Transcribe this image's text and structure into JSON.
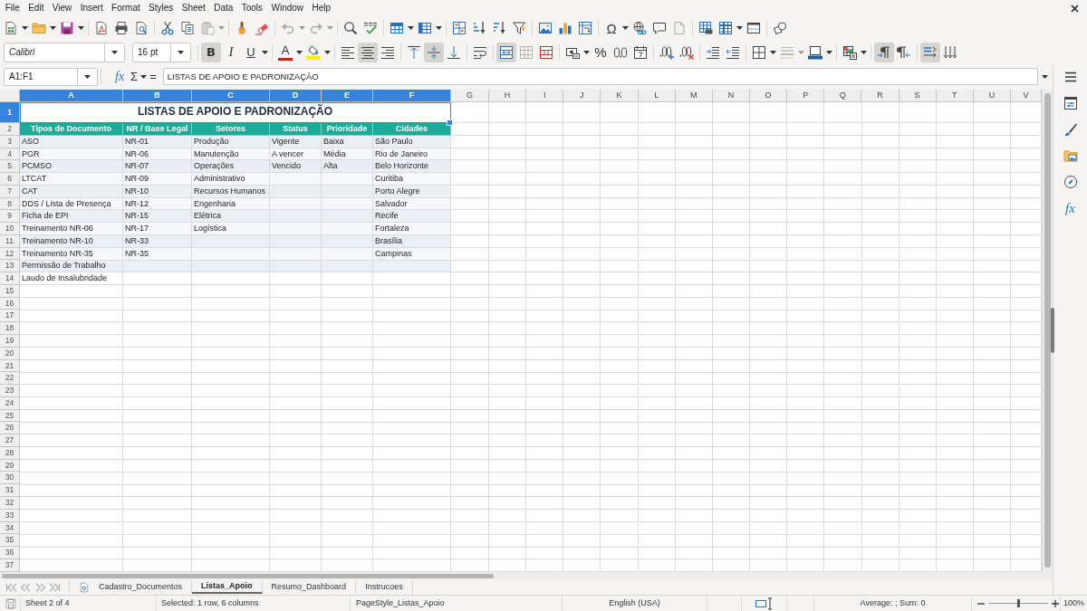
{
  "menu": [
    "File",
    "Edit",
    "View",
    "Insert",
    "Format",
    "Styles",
    "Sheet",
    "Data",
    "Tools",
    "Window",
    "Help"
  ],
  "standard_toolbar": {
    "paste_enabled": false,
    "undo_enabled": false,
    "redo_enabled": false,
    "special_character_glyph": "Ω",
    "header_footer_enabled": false
  },
  "formatting_toolbar": {
    "font_name": "Calibri",
    "font_size": "16 pt",
    "bold_glyph": "B",
    "bold": true,
    "italic_glyph": "I",
    "italic": false,
    "underline_glyph": "U",
    "underline": false,
    "font_color_glyph": "A",
    "align_left": false,
    "align_center": true,
    "align_right": false,
    "align_top": false,
    "align_middle": true,
    "align_bottom": false,
    "merge_and_center": true,
    "merge_enabled": false,
    "percent_glyph": "%",
    "border_style_enabled": false,
    "left_to_right": true,
    "right_to_left": false,
    "horizontal_text": true,
    "vertical_text": false
  },
  "formula_bar": {
    "name_box": "A1:F1",
    "function_glyph": "fx",
    "sum_glyph": "Σ",
    "equals_glyph": "=",
    "formula": "LISTAS DE APOIO E PADRONIZAÇÃO"
  },
  "sheet": {
    "column_headers": [
      {
        "label": "A",
        "selected": true
      },
      {
        "label": "B",
        "selected": true
      },
      {
        "label": "C",
        "selected": true
      },
      {
        "label": "D",
        "selected": true
      },
      {
        "label": "E",
        "selected": true
      },
      {
        "label": "F",
        "selected": true
      },
      {
        "label": "G",
        "selected": false
      },
      {
        "label": "H",
        "selected": false
      },
      {
        "label": "I",
        "selected": false
      },
      {
        "label": "J",
        "selected": false
      },
      {
        "label": "K",
        "selected": false
      },
      {
        "label": "L",
        "selected": false
      },
      {
        "label": "M",
        "selected": false
      },
      {
        "label": "N",
        "selected": false
      },
      {
        "label": "O",
        "selected": false
      },
      {
        "label": "P",
        "selected": false
      },
      {
        "label": "Q",
        "selected": false
      },
      {
        "label": "R",
        "selected": false
      },
      {
        "label": "S",
        "selected": false
      },
      {
        "label": "T",
        "selected": false
      },
      {
        "label": "U",
        "selected": false
      },
      {
        "label": "V",
        "selected": false
      }
    ],
    "row_headers": [
      {
        "label": "1",
        "selected": true
      },
      {
        "label": "2",
        "selected": false
      },
      {
        "label": "3",
        "selected": false
      },
      {
        "label": "4",
        "selected": false
      },
      {
        "label": "5",
        "selected": false
      },
      {
        "label": "6",
        "selected": false
      },
      {
        "label": "7",
        "selected": false
      },
      {
        "label": "8",
        "selected": false
      },
      {
        "label": "9",
        "selected": false
      },
      {
        "label": "10",
        "selected": false
      },
      {
        "label": "11",
        "selected": false
      },
      {
        "label": "12",
        "selected": false
      },
      {
        "label": "13",
        "selected": false
      },
      {
        "label": "14",
        "selected": false
      },
      {
        "label": "15",
        "selected": false
      },
      {
        "label": "16",
        "selected": false
      },
      {
        "label": "17",
        "selected": false
      },
      {
        "label": "18",
        "selected": false
      },
      {
        "label": "19",
        "selected": false
      },
      {
        "label": "20",
        "selected": false
      },
      {
        "label": "21",
        "selected": false
      },
      {
        "label": "22",
        "selected": false
      },
      {
        "label": "23",
        "selected": false
      },
      {
        "label": "24",
        "selected": false
      },
      {
        "label": "25",
        "selected": false
      },
      {
        "label": "26",
        "selected": false
      },
      {
        "label": "27",
        "selected": false
      },
      {
        "label": "28",
        "selected": false
      },
      {
        "label": "29",
        "selected": false
      },
      {
        "label": "30",
        "selected": false
      },
      {
        "label": "31",
        "selected": false
      },
      {
        "label": "32",
        "selected": false
      },
      {
        "label": "33",
        "selected": false
      },
      {
        "label": "34",
        "selected": false
      },
      {
        "label": "35",
        "selected": false
      },
      {
        "label": "36",
        "selected": false
      },
      {
        "label": "37",
        "selected": false
      }
    ],
    "title": "LISTAS DE APOIO E PADRONIZAÇÃO",
    "headers": [
      "Tipos de Documento",
      "NR / Base Legal",
      "Setores",
      "Status",
      "Prioridade",
      "Cidades"
    ],
    "lists": [
      [
        "ASO",
        "PGR",
        "PCMSO",
        "LTCAT",
        "CAT",
        "DDS / Lista de Presença",
        "Ficha de EPI",
        "Treinamento NR-06",
        "Treinamento NR-10",
        "Treinamento NR-35",
        "Permissão de Trabalho",
        "Laudo de Insalubridade"
      ],
      [
        "NR-01",
        "NR-06",
        "NR-07",
        "NR-09",
        "NR-10",
        "NR-12",
        "NR-15",
        "NR-17",
        "NR-33",
        "NR-35"
      ],
      [
        "Produção",
        "Manutenção",
        "Operações",
        "Administrativo",
        "Recursos Humanos",
        "Engenharia",
        "Elétrica",
        "Logística"
      ],
      [
        "Vigente",
        "A vencer",
        "Vencido"
      ],
      [
        "Baixa",
        "Média",
        "Alta"
      ],
      [
        "São Paulo",
        "Rio de Janeiro",
        "Belo Horizonte",
        "Curitiba",
        "Porto Alegre",
        "Salvador",
        "Recife",
        "Fortaleza",
        "Brasília",
        "Campinas"
      ]
    ]
  },
  "sheet_tabs": [
    {
      "label": "Cadastro_Documentos",
      "selected": false
    },
    {
      "label": "Listas_Apoio",
      "selected": true
    },
    {
      "label": "Resumo_Dashboard",
      "selected": false
    },
    {
      "label": "Instrucoes",
      "selected": false
    }
  ],
  "sidebar": {
    "functions_glyph": "fx"
  },
  "status_bar": {
    "sheet_position": "Sheet 2 of 4",
    "selection": "Selected: 1 row, 6 columns",
    "page_style": "PageStyle_Listas_Apoio",
    "language": "English (USA)",
    "statistics": "Average: ; Sum: 0",
    "zoom": {
      "level": 0.5,
      "reading": "100%"
    }
  }
}
